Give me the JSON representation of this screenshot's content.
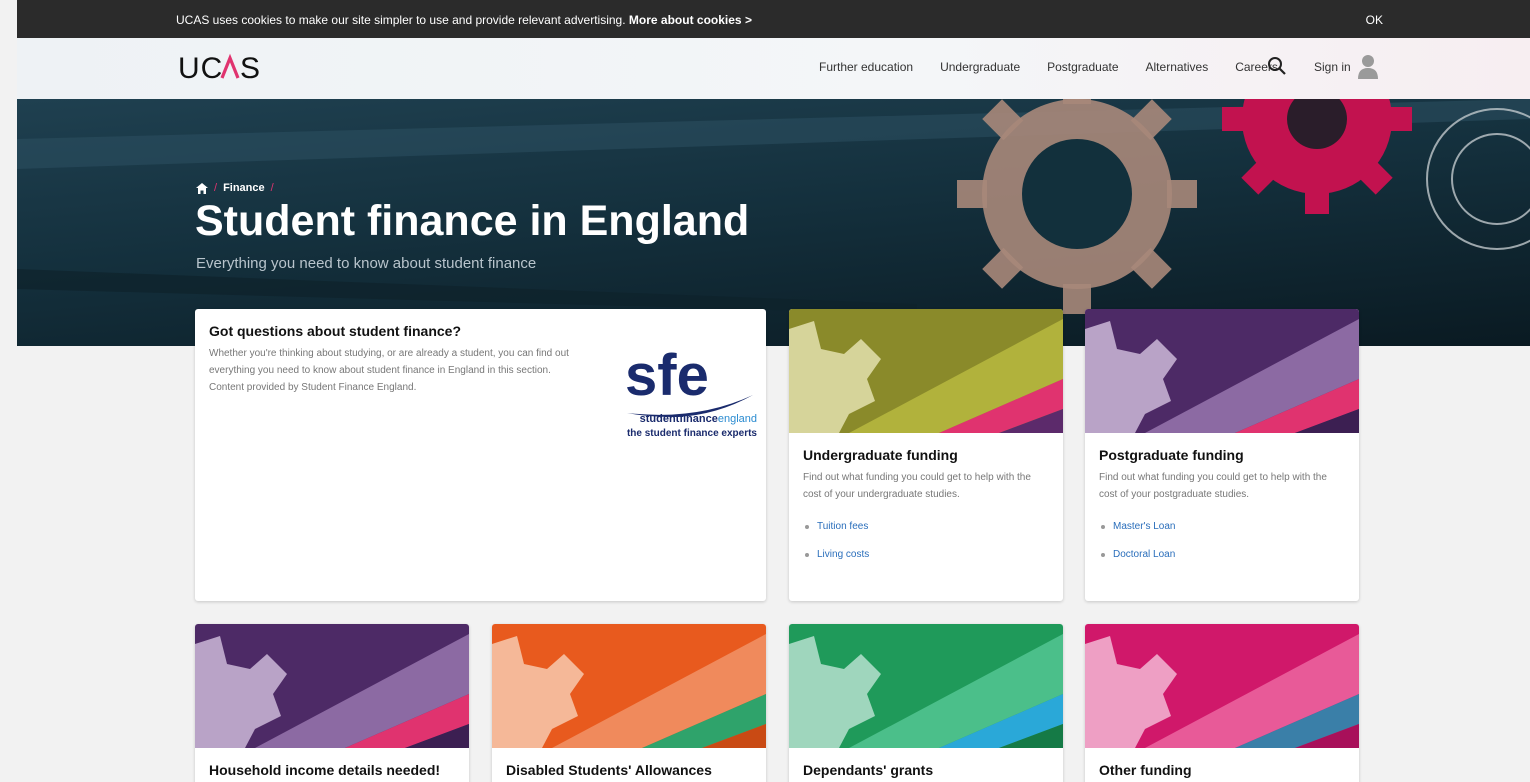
{
  "cookie_bar": {
    "text": "UCAS uses cookies to make our site simpler to use and provide relevant advertising.",
    "link_label": "More about cookies",
    "link_chevron": ">",
    "ok_label": "OK"
  },
  "header": {
    "logo": "UC/\\S",
    "nav_items": [
      "Further education",
      "Undergraduate",
      "Postgraduate",
      "Alternatives",
      "Careers"
    ],
    "search_icon": "search-icon",
    "signin_label": "Sign in",
    "user_icon": "user-icon"
  },
  "hero": {
    "breadcrumb": {
      "home_icon": "home-icon",
      "separator": "/",
      "current": "Finance"
    },
    "title": "Student finance in England",
    "subtitle": "Everything you need to know about student finance"
  },
  "intro_card": {
    "title": "Got questions about student finance?",
    "description": "Whether you're thinking about studying, or are already a student, you can find out everything you need to know about student finance in England in this section. Content provided by Student Finance England.",
    "logo_text": "sfe",
    "logo_caption_1a": "studentfinance",
    "logo_caption_1b": "england",
    "logo_caption_2": "the student finance experts"
  },
  "cards": [
    {
      "title": "Undergraduate funding",
      "description": "Find out what funding you could get to help with the cost of your undergraduate studies.",
      "links": [
        "Tuition fees",
        "Living costs"
      ],
      "colors": {
        "bg": "#8a8a2a",
        "stripe1": "#b1b23c",
        "stripe2": "#e0336f",
        "stripe3": "#5c2a6b",
        "gear": "#d6d49a"
      }
    },
    {
      "title": "Postgraduate funding",
      "description": "Find out what funding you could get to help with the cost of your postgraduate studies.",
      "links": [
        "Master's Loan",
        "Doctoral Loan"
      ],
      "colors": {
        "bg": "#4d2a66",
        "stripe1": "#8c6aa3",
        "stripe2": "#e0336f",
        "stripe3": "#3c1f52",
        "gear": "#b9a3c7"
      }
    },
    {
      "title": "Household income details needed!",
      "colors": {
        "bg": "#4d2a66",
        "stripe1": "#8c6aa3",
        "stripe2": "#e0336f",
        "stripe3": "#3c1f52",
        "gear": "#b9a3c7"
      }
    },
    {
      "title": "Disabled Students' Allowances",
      "colors": {
        "bg": "#e85a1e",
        "stripe1": "#f08a5c",
        "stripe2": "#2fa36b",
        "stripe3": "#c94a14",
        "gear": "#f5b898"
      }
    },
    {
      "title": "Dependants' grants",
      "colors": {
        "bg": "#1f9a5a",
        "stripe1": "#4bbf8a",
        "stripe2": "#2aa8d8",
        "stripe3": "#157a46",
        "gear": "#9fd6bd"
      }
    },
    {
      "title": "Other funding",
      "colors": {
        "bg": "#d0186a",
        "stripe1": "#e85a98",
        "stripe2": "#3a7fa8",
        "stripe3": "#a8105a",
        "gear": "#ee9fc4"
      }
    }
  ]
}
